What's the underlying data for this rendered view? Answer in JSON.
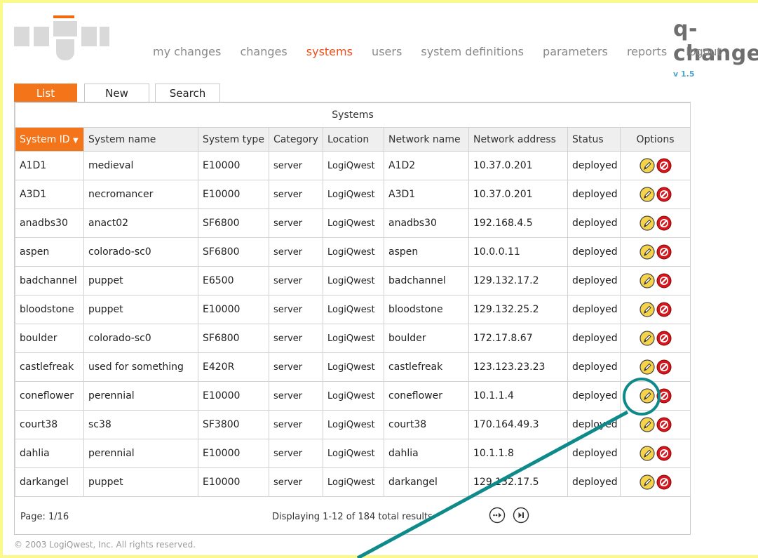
{
  "brand": {
    "name": "q-change",
    "tm": "™",
    "version": "v 1.5"
  },
  "nav": [
    {
      "label": "my changes",
      "active": false
    },
    {
      "label": "changes",
      "active": false
    },
    {
      "label": "systems",
      "active": true
    },
    {
      "label": "users",
      "active": false
    },
    {
      "label": "system definitions",
      "active": false
    },
    {
      "label": "parameters",
      "active": false
    },
    {
      "label": "reports",
      "active": false
    },
    {
      "label": "logout",
      "active": false
    }
  ],
  "tabs": [
    {
      "label": "List",
      "active": true
    },
    {
      "label": "New",
      "active": false
    },
    {
      "label": "Search",
      "active": false
    }
  ],
  "table": {
    "caption": "Systems",
    "columns": [
      "System ID",
      "System name",
      "System type",
      "Category",
      "Location",
      "Network name",
      "Network address",
      "Status",
      "Options"
    ],
    "sort_indicator": "▼",
    "rows": [
      [
        "A1D1",
        "medieval",
        "E10000",
        "server",
        "LogiQwest",
        "A1D2",
        "10.37.0.201",
        "deployed"
      ],
      [
        "A3D1",
        "necromancer",
        "E10000",
        "server",
        "LogiQwest",
        "A3D1",
        "10.37.0.201",
        "deployed"
      ],
      [
        "anadbs30",
        "anact02",
        "SF6800",
        "server",
        "LogiQwest",
        "anadbs30",
        "192.168.4.5",
        "deployed"
      ],
      [
        "aspen",
        "colorado-sc0",
        "SF6800",
        "server",
        "LogiQwest",
        "aspen",
        "10.0.0.11",
        "deployed"
      ],
      [
        "badchannel",
        "puppet",
        "E6500",
        "server",
        "LogiQwest",
        "badchannel",
        "129.132.17.2",
        "deployed"
      ],
      [
        "bloodstone",
        "puppet",
        "E10000",
        "server",
        "LogiQwest",
        "bloodstone",
        "129.132.25.2",
        "deployed"
      ],
      [
        "boulder",
        "colorado-sc0",
        "SF6800",
        "server",
        "LogiQwest",
        "boulder",
        "172.17.8.67",
        "deployed"
      ],
      [
        "castlefreak",
        "used for something",
        "E420R",
        "server",
        "LogiQwest",
        "castlefreak",
        "123.123.23.23",
        "deployed"
      ],
      [
        "coneflower",
        "perennial",
        "E10000",
        "server",
        "LogiQwest",
        "coneflower",
        "10.1.1.4",
        "deployed"
      ],
      [
        "court38",
        "sc38",
        "SF3800",
        "server",
        "LogiQwest",
        "court38",
        "170.164.49.3",
        "deployed"
      ],
      [
        "dahlia",
        "perennial",
        "E10000",
        "server",
        "LogiQwest",
        "dahlia",
        "10.1.1.8",
        "deployed"
      ],
      [
        "darkangel",
        "puppet",
        "E10000",
        "server",
        "LogiQwest",
        "darkangel",
        "129.132.17.5",
        "deployed"
      ]
    ],
    "row_icons": [
      "edit-pencil-icon",
      "delete-prohibited-icon"
    ]
  },
  "footer": {
    "page": "Page: 1/16",
    "displaying": "Displaying 1-12 of 184 total results",
    "pager_icons": [
      "next-page-icon",
      "last-page-icon"
    ]
  },
  "copyright": "© 2003  LogiQwest, Inc. All rights reserved.",
  "colors": {
    "accent": "#f37419",
    "nav_active": "#f04e16",
    "frame": "#fbf98a",
    "annotation": "#0f8a8a",
    "delete_red": "#d9141c",
    "edit_yellow": "#f5d34a"
  }
}
